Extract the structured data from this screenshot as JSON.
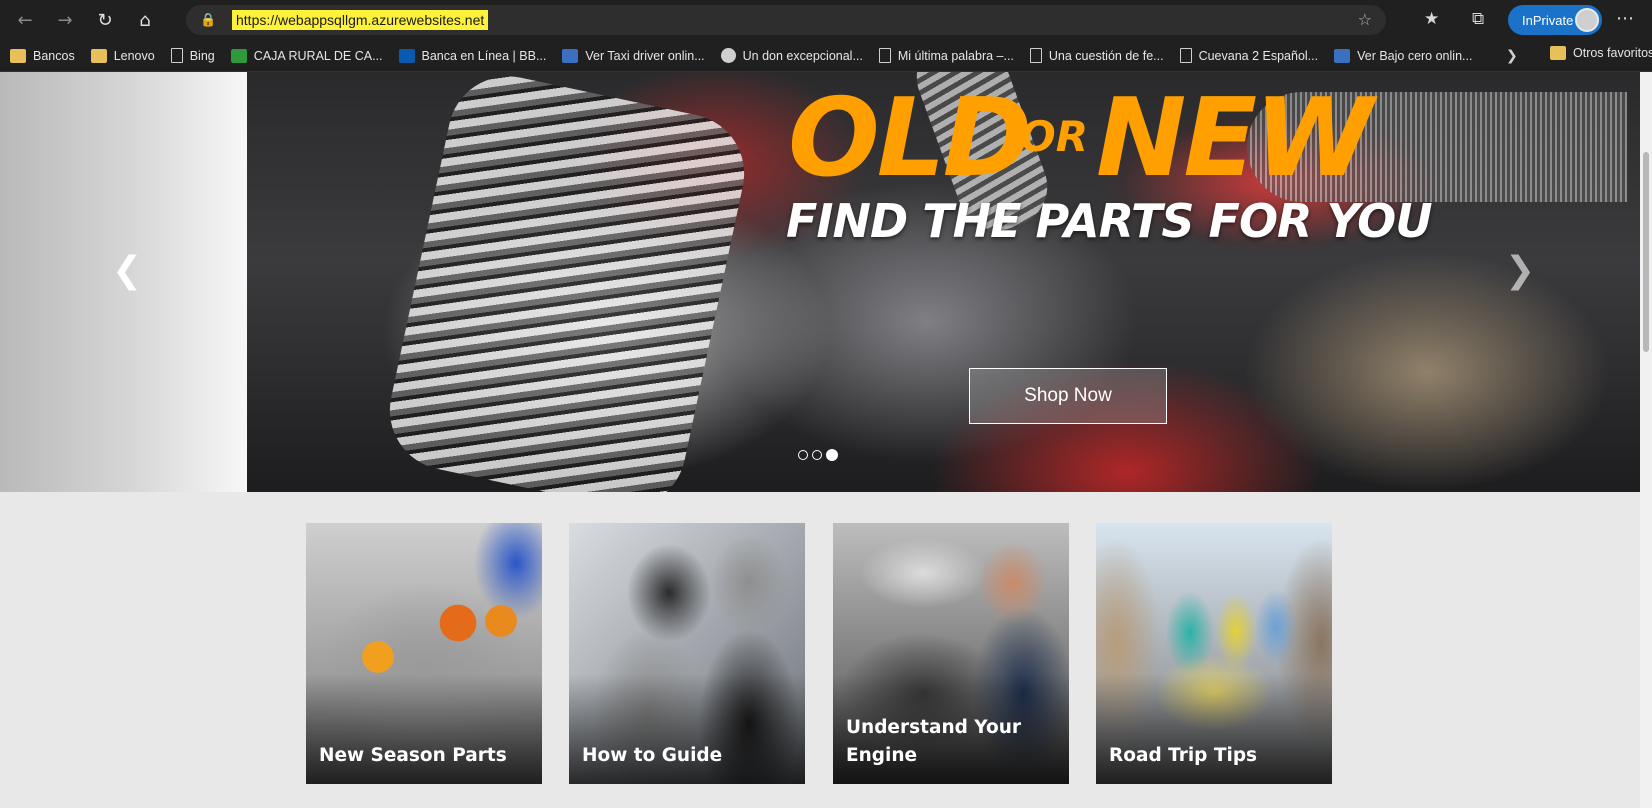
{
  "browser": {
    "url": "https://webappsqllgm.azurewebsites.net",
    "inprivate_label": "InPrivate"
  },
  "bookmarks": [
    {
      "label": "Bancos",
      "icon": "folder-icon"
    },
    {
      "label": "Lenovo",
      "icon": "folder-icon"
    },
    {
      "label": "Bing",
      "icon": "page-icon"
    },
    {
      "label": "CAJA RURAL DE CA...",
      "icon": "caja-rural-icon"
    },
    {
      "label": "Banca en Línea | BB...",
      "icon": "bbva-icon"
    },
    {
      "label": "Ver Taxi driver onlin...",
      "icon": "video-site-icon"
    },
    {
      "label": "Un don excepcional...",
      "icon": "wordpress-icon"
    },
    {
      "label": "Mi última palabra –...",
      "icon": "page-icon"
    },
    {
      "label": "Una cuestión de fe...",
      "icon": "page-icon"
    },
    {
      "label": "Cuevana 2 Español...",
      "icon": "page-icon"
    },
    {
      "label": "Ver Bajo cero onlin...",
      "icon": "video-site-icon"
    }
  ],
  "other_favorites": "Otros favoritos",
  "hero": {
    "headline_old": "OLD",
    "headline_or": "OR",
    "headline_new": "NEW",
    "tagline": "FIND THE PARTS FOR YOU",
    "cta": "Shop Now",
    "slide_count": 3,
    "active_slide": 3
  },
  "cards": [
    {
      "label": "New Season Parts"
    },
    {
      "label": "How to Guide"
    },
    {
      "label": "Understand Your Engine"
    },
    {
      "label": "Road Trip Tips"
    }
  ],
  "colors": {
    "accent": "#ffa000",
    "chrome": "#202020",
    "inprivate": "#1a73c8",
    "url_highlight": "#fff23a"
  }
}
